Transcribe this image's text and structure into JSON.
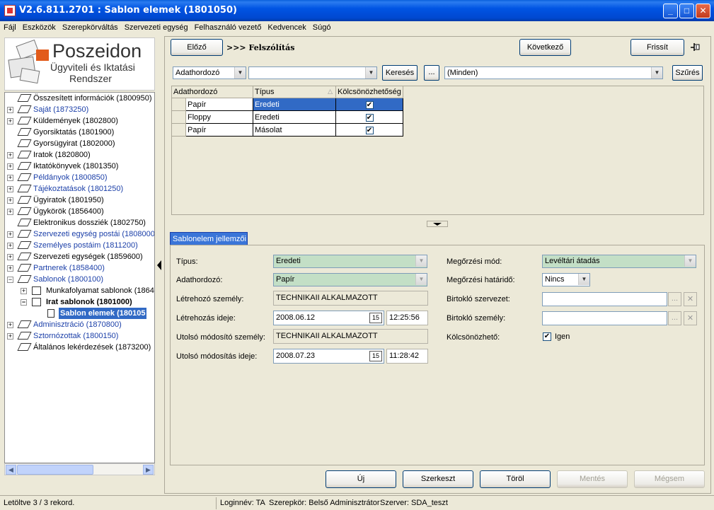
{
  "window": {
    "title": "V2.6.811.2701 : Sablon elemek (1801050)"
  },
  "menu": [
    "Fájl",
    "Eszközök",
    "Szerepkörváltás",
    "Szervezeti egység",
    "Felhasználó vezető",
    "Kedvencek",
    "Súgó"
  ],
  "logo": {
    "name": "Poszeidon",
    "line2": "Ügyviteli és Iktatási",
    "line3": "Rendszer"
  },
  "tree": [
    {
      "label": "Összesített információk (1800950)",
      "expander": "",
      "blue": false
    },
    {
      "label": "Saját (1873250)",
      "expander": "+",
      "blue": true
    },
    {
      "label": "Küldemények (1802800)",
      "expander": "+",
      "blue": false
    },
    {
      "label": "Gyorsiktatás (1801900)",
      "expander": "",
      "blue": false
    },
    {
      "label": "Gyorsügyirat (1802000)",
      "expander": "",
      "blue": false
    },
    {
      "label": "Iratok (1820800)",
      "expander": "+",
      "blue": false
    },
    {
      "label": "Iktatókönyvek (1801350)",
      "expander": "+",
      "blue": false
    },
    {
      "label": "Példányok (1800850)",
      "expander": "+",
      "blue": true
    },
    {
      "label": "Tájékoztatások (1801250)",
      "expander": "+",
      "blue": true
    },
    {
      "label": "Ügyiratok (1801950)",
      "expander": "+",
      "blue": false
    },
    {
      "label": "Ügykörök (1856400)",
      "expander": "+",
      "blue": false
    },
    {
      "label": "Elektronikus dossziék (1802750)",
      "expander": "",
      "blue": false
    },
    {
      "label": "Szervezeti egység postái (1808000)",
      "expander": "+",
      "blue": true
    },
    {
      "label": "Személyes postáim (1811200)",
      "expander": "+",
      "blue": true
    },
    {
      "label": "Szervezeti egységek (1859600)",
      "expander": "+",
      "blue": false
    },
    {
      "label": "Partnerek (1858400)",
      "expander": "+",
      "blue": true
    },
    {
      "label": "Sablonok (1800100)",
      "expander": "−",
      "blue": true
    },
    {
      "label": "Munkafolyamat sablonok (18644",
      "expander": "+",
      "blue": false
    },
    {
      "label": "Irat sablonok (1801000)",
      "expander": "−",
      "blue": false
    },
    {
      "label": "Sablon elemek (180105",
      "expander": "",
      "blue": false
    },
    {
      "label": "Adminisztráció (1870800)",
      "expander": "+",
      "blue": true
    },
    {
      "label": "Sztornózottak (1800150)",
      "expander": "+",
      "blue": true
    },
    {
      "label": "Általános lekérdezések (1873200)",
      "expander": "",
      "blue": false
    }
  ],
  "nav": {
    "prev": "Előző",
    "breadcrumb": ">>> Felszólítás",
    "next": "Következő",
    "refresh": "Frissít"
  },
  "filter": {
    "field": "Adathordozó",
    "value": "",
    "search": "Keresés",
    "dots": "...",
    "scope": "(Minden)",
    "filter_btn": "Szűrés"
  },
  "grid": {
    "columns": [
      "Adathordozó",
      "Típus",
      "Kölcsönözhetőség"
    ],
    "rows": [
      {
        "c1": "Papír",
        "c2": "Eredeti",
        "c3": "✔"
      },
      {
        "c1": "Floppy",
        "c2": "Eredeti",
        "c3": "✔"
      },
      {
        "c1": "Papír",
        "c2": "Másolat",
        "c3": "✔"
      }
    ]
  },
  "tab": {
    "label": "Sablonelem jellemzői"
  },
  "form": {
    "tipus_label": "Típus:",
    "tipus_value": "Eredeti",
    "adathordozo_label": "Adathordozó:",
    "adathordozo_value": "Papír",
    "letrehozo_label": "Létrehozó személy:",
    "letrehozo_value": "TECHNIKAII ALKALMAZOTT",
    "letrehozas_label": "Létrehozás ideje:",
    "letrehozas_date": "2008.06.12",
    "letrehozas_time": "12:25:56",
    "modosito_label": "Utolsó módosító személy:",
    "modosito_value": "TECHNIKAII ALKALMAZOTT",
    "modositas_label": "Utolsó módosítás ideje:",
    "modositas_date": "2008.07.23",
    "modositas_time": "11:28:42",
    "megorzesi_mod_label": "Megőrzési mód:",
    "megorzesi_mod_value": "Levéltári átadás",
    "hatarido_label": "Megőrzési határidő:",
    "hatarido_value": "Nincs",
    "birtoklo_szerv_label": "Birtokló szervezet:",
    "birtoklo_szem_label": "Birtokló személy:",
    "kolcson_label": "Kölcsönözhető:",
    "kolcson_value": "Igen",
    "cal_icon": "15"
  },
  "actions": {
    "new": "Új",
    "edit": "Szerkeszt",
    "delete": "Töröl",
    "save": "Mentés",
    "cancel": "Mégsem"
  },
  "status": {
    "records": "Letöltve 3 / 3 rekord.",
    "login": "Loginnév: TA",
    "role": "Szerepkör: Belső Adminisztrátor",
    "server": "Szerver: SDA_teszt"
  }
}
